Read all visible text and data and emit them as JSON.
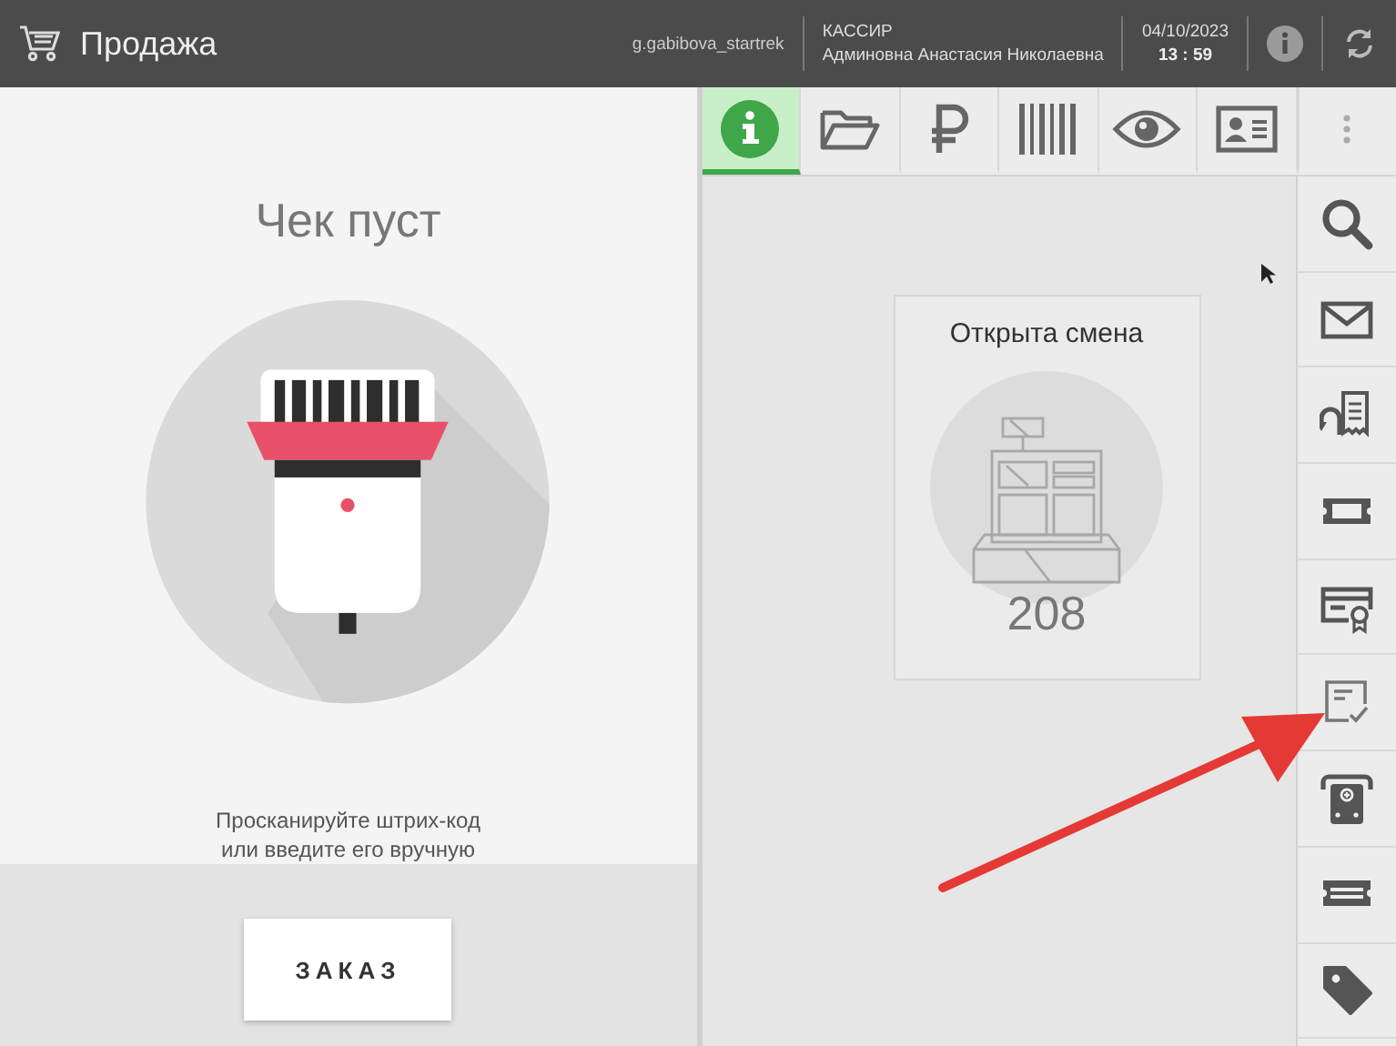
{
  "header": {
    "title": "Продажа",
    "login": "g.gabibova_startrek",
    "role": "КАССИР",
    "cashier": "Админовна Анастасия Николаевна",
    "date": "04/10/2023",
    "time": "13 : 59"
  },
  "receipt": {
    "title": "Чек пуст",
    "hint_lines": [
      "Просканируйте штрих-код",
      "или введите его вручную"
    ],
    "order_button": "ЗАКАЗ"
  },
  "tabs": [
    {
      "kind": "info",
      "selected": true
    },
    {
      "kind": "folder",
      "selected": false
    },
    {
      "kind": "ruble",
      "selected": false
    },
    {
      "kind": "barcode",
      "selected": false
    },
    {
      "kind": "eye",
      "selected": false
    },
    {
      "kind": "id-card",
      "selected": false
    },
    {
      "kind": "more",
      "selected": false
    }
  ],
  "shift_card": {
    "title": "Открыта смена",
    "number": "208"
  },
  "tools": [
    {
      "kind": "search"
    },
    {
      "kind": "mail"
    },
    {
      "kind": "return"
    },
    {
      "kind": "ticket"
    },
    {
      "kind": "certificate"
    },
    {
      "kind": "checklist"
    },
    {
      "kind": "terminal"
    },
    {
      "kind": "coupon"
    },
    {
      "kind": "tag"
    }
  ]
}
